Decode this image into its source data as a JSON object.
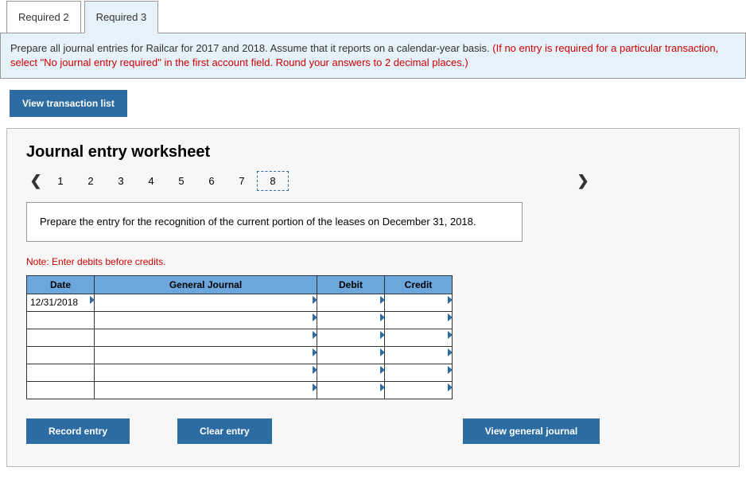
{
  "tabs": [
    {
      "label": "Required 2",
      "active": false
    },
    {
      "label": "Required 3",
      "active": true
    }
  ],
  "instruction": {
    "main": "Prepare all journal entries for Railcar for 2017 and 2018. Assume that it reports on a calendar-year basis. ",
    "note": "(If no entry is required for a particular transaction, select \"No journal entry required\" in the first account field. Round your answers to 2 decimal places.)"
  },
  "buttons": {
    "view_list": "View transaction list",
    "record": "Record entry",
    "clear": "Clear entry",
    "view_journal": "View general journal"
  },
  "worksheet": {
    "title": "Journal entry worksheet",
    "steps": [
      "1",
      "2",
      "3",
      "4",
      "5",
      "6",
      "7",
      "8"
    ],
    "active_step": "8",
    "prompt": "Prepare the entry for the recognition of the current portion of the leases on December 31, 2018.",
    "note": "Note: Enter debits before credits.",
    "headers": {
      "date": "Date",
      "gj": "General Journal",
      "debit": "Debit",
      "credit": "Credit"
    },
    "rows": [
      {
        "date": "12/31/2018",
        "gj": "",
        "debit": "",
        "credit": ""
      },
      {
        "date": "",
        "gj": "",
        "debit": "",
        "credit": ""
      },
      {
        "date": "",
        "gj": "",
        "debit": "",
        "credit": ""
      },
      {
        "date": "",
        "gj": "",
        "debit": "",
        "credit": ""
      },
      {
        "date": "",
        "gj": "",
        "debit": "",
        "credit": ""
      },
      {
        "date": "",
        "gj": "",
        "debit": "",
        "credit": ""
      }
    ]
  },
  "chart_data": {
    "type": "table",
    "title": "Journal entry worksheet — step 8",
    "columns": [
      "Date",
      "General Journal",
      "Debit",
      "Credit"
    ],
    "rows": [
      [
        "12/31/2018",
        "",
        "",
        ""
      ],
      [
        "",
        "",
        "",
        ""
      ],
      [
        "",
        "",
        "",
        ""
      ],
      [
        "",
        "",
        "",
        ""
      ],
      [
        "",
        "",
        "",
        ""
      ],
      [
        "",
        "",
        "",
        ""
      ]
    ]
  }
}
